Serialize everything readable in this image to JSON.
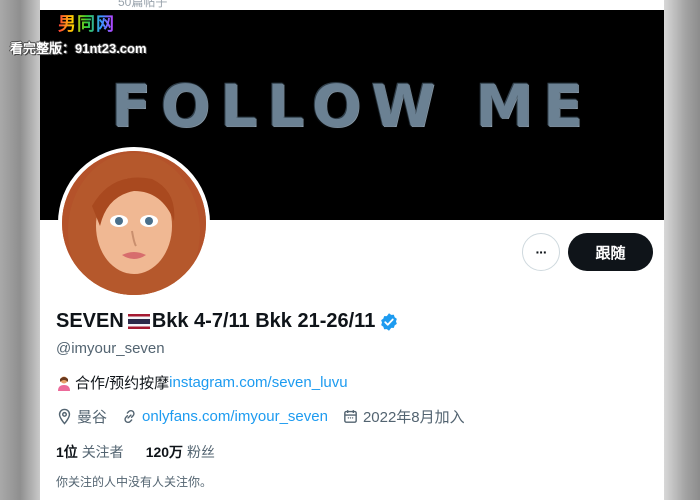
{
  "watermark": {
    "logo": "男同网",
    "text": "看完整版：91nt23.com"
  },
  "top_strip": {
    "text": "50篇帖子"
  },
  "banner": {
    "text": "FOLLOW ME"
  },
  "actions": {
    "more_label": "···",
    "follow_label": "跟随"
  },
  "profile": {
    "name_prefix": "SEVEN",
    "name_suffix": "Bkk 4-7/11 Bkk 21-26/11",
    "handle": "@imyour_seven",
    "bio_text": "合作/预约按摩",
    "bio_link": "instagram.com/seven_luvu",
    "location": "曼谷",
    "website": "onlyfans.com/imyour_seven",
    "joined": "2022年8月加入",
    "following_count": "1位",
    "following_label": "关注者",
    "followers_count": "120万",
    "followers_label": "粉丝",
    "no_mutuals_note": "你关注的人中没有人关注你。"
  },
  "colors": {
    "accent": "#1d9bf0",
    "text_primary": "#0f1419",
    "text_secondary": "#536471",
    "follow_button": "#0f1419"
  }
}
